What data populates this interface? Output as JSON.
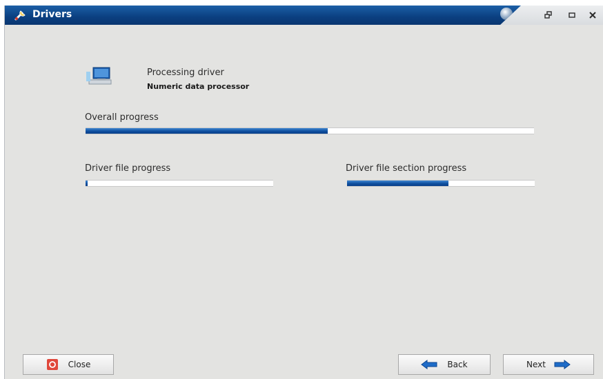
{
  "window": {
    "title": "Drivers",
    "icon": "wrench-icon",
    "controls": [
      "restore-icon",
      "minimize-icon",
      "close-icon"
    ]
  },
  "processing": {
    "heading": "Processing driver",
    "driver_name": "Numeric data processor",
    "icon": "driver-monitor-icon"
  },
  "overall_progress": {
    "label": "Overall progress",
    "value": 0.54
  },
  "file_progress": {
    "label": "Driver file progress",
    "value": 0.01
  },
  "section_progress": {
    "label": "Driver file section progress",
    "value": 0.54
  },
  "buttons": {
    "close": {
      "label": "Close",
      "icon": "close-circle-icon"
    },
    "back": {
      "label": "Back",
      "icon": "arrow-left-icon"
    },
    "next": {
      "label": "Next",
      "icon": "arrow-right-icon"
    }
  },
  "colors": {
    "title_bar": "#0b3f80",
    "progress_fill": "#0e4f9e",
    "window_bg": "#e3e3e1",
    "close_icon": "#e0473b"
  }
}
